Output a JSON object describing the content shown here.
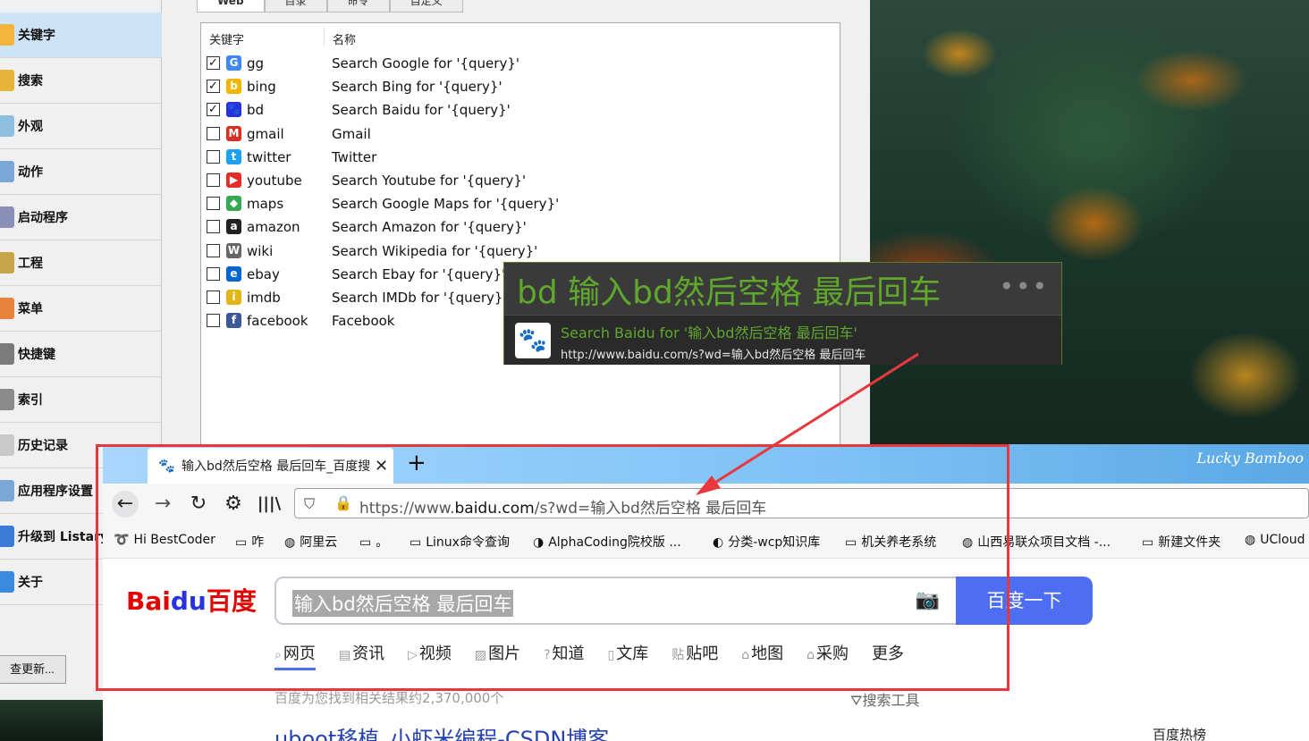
{
  "sidebar": {
    "items": [
      {
        "label": "关键字",
        "icon": "keyword-icon",
        "color": "#f2b43a",
        "selected": true
      },
      {
        "label": "搜索",
        "icon": "magnifier-icon",
        "color": "#e7b43a",
        "selected": false
      },
      {
        "label": "外观",
        "icon": "palette-icon",
        "color": "#8ebfe0",
        "selected": false
      },
      {
        "label": "动作",
        "icon": "action-icon",
        "color": "#7aa7d6",
        "selected": false
      },
      {
        "label": "启动程序",
        "icon": "launcher-icon",
        "color": "#8a8fb8",
        "selected": false
      },
      {
        "label": "工程",
        "icon": "project-icon",
        "color": "#c8a54a",
        "selected": false
      },
      {
        "label": "菜单",
        "icon": "menu-icon",
        "color": "#e8823a",
        "selected": false
      },
      {
        "label": "快捷键",
        "icon": "keyboard-icon",
        "color": "#7a7a7a",
        "selected": false
      },
      {
        "label": "索引",
        "icon": "index-icon",
        "color": "#8a8a8a",
        "selected": false
      },
      {
        "label": "历史记录",
        "icon": "history-icon",
        "color": "#c9c9c9",
        "selected": false
      },
      {
        "label": "应用程序设置",
        "icon": "app-settings-icon",
        "color": "#7aa7d6",
        "selected": false
      },
      {
        "label": "升级到 Listary",
        "icon": "upgrade-icon",
        "color": "#3a7bd5",
        "selected": false
      },
      {
        "label": "关于",
        "icon": "about-icon",
        "color": "#3a8be0",
        "selected": false
      }
    ],
    "check_update": "查更新..."
  },
  "tabs": [
    "Web",
    "目录",
    "命令",
    "自定义"
  ],
  "list": {
    "col_keyword": "关键字",
    "col_name": "名称",
    "rows": [
      {
        "checked": true,
        "kw": "gg",
        "name": "Search Google for '{query}'",
        "icon": "google-icon",
        "color": "#4285f4",
        "glyph": "G"
      },
      {
        "checked": true,
        "kw": "bing",
        "name": "Search Bing for '{query}'",
        "icon": "bing-icon",
        "color": "#f5b400",
        "glyph": "b"
      },
      {
        "checked": true,
        "kw": "bd",
        "name": "Search Baidu for '{query}'",
        "icon": "baidu-icon",
        "color": "#2932e1",
        "glyph": "🐾"
      },
      {
        "checked": false,
        "kw": "gmail",
        "name": "Gmail",
        "icon": "gmail-icon",
        "color": "#d93025",
        "glyph": "M"
      },
      {
        "checked": false,
        "kw": "twitter",
        "name": "Twitter",
        "icon": "twitter-icon",
        "color": "#1da1f2",
        "glyph": "t"
      },
      {
        "checked": false,
        "kw": "youtube",
        "name": "Search Youtube for '{query}'",
        "icon": "youtube-icon",
        "color": "#e52d27",
        "glyph": "▶"
      },
      {
        "checked": false,
        "kw": "maps",
        "name": "Search Google Maps for '{query}'",
        "icon": "maps-icon",
        "color": "#34a853",
        "glyph": "◆"
      },
      {
        "checked": false,
        "kw": "amazon",
        "name": "Search Amazon for '{query}'",
        "icon": "amazon-icon",
        "color": "#222222",
        "glyph": "a"
      },
      {
        "checked": false,
        "kw": "wiki",
        "name": "Search Wikipedia for '{query}'",
        "icon": "wikipedia-icon",
        "color": "#666666",
        "glyph": "W"
      },
      {
        "checked": false,
        "kw": "ebay",
        "name": "Search Ebay for '{query}'",
        "icon": "ebay-icon",
        "color": "#0064d2",
        "glyph": "e"
      },
      {
        "checked": false,
        "kw": "imdb",
        "name": "Search IMDb for '{query}'",
        "icon": "imdb-icon",
        "color": "#e2b616",
        "glyph": "i"
      },
      {
        "checked": false,
        "kw": "facebook",
        "name": "Facebook",
        "icon": "facebook-icon",
        "color": "#3b5998",
        "glyph": "f"
      }
    ]
  },
  "popup": {
    "query": "bd 输入bd然后空格 最后回车",
    "more": "•••",
    "result_title": "Search Baidu for '输入bd然后空格 最后回车'",
    "result_url": "http://www.baidu.com/s?wd=输入bd然后空格 最后回车"
  },
  "browser": {
    "tab_title": "输入bd然后空格 最后回车_百度搜索",
    "theme_text": "Lucky Bamboo",
    "url_prefix": "https://www.",
    "url_domain": "baidu.com",
    "url_rest": "/s?wd=输入bd然后空格 最后回车",
    "bookmarks": [
      "Hi BestCoder",
      "咋",
      "阿里云",
      "。",
      "Linux命令查询",
      "AlphaCoding院校版 ...",
      "分类-wcp知识库",
      "机关养老系统",
      "山西易联众项目文档 -...",
      "新建文件夹",
      "UCloud"
    ]
  },
  "baidu": {
    "logo_bai": "Bai",
    "logo_du": "du",
    "logo_cn": "百度",
    "search_value": "输入bd然后空格 最后回车",
    "search_button": "百度一下",
    "tabs": [
      "网页",
      "资讯",
      "视频",
      "图片",
      "知道",
      "文库",
      "贴吧",
      "地图",
      "采购",
      "更多"
    ],
    "result_count": "百度为您找到相关结果约2,370,000个",
    "search_tools": "搜索工具",
    "first_result": "uboot移植_小虾米编程-CSDN博客",
    "hot": "百度热榜"
  },
  "colors": {
    "annotation_red": "#e8383d",
    "popup_green": "#5fa82c",
    "baidu_blue": "#4e6ef2"
  }
}
